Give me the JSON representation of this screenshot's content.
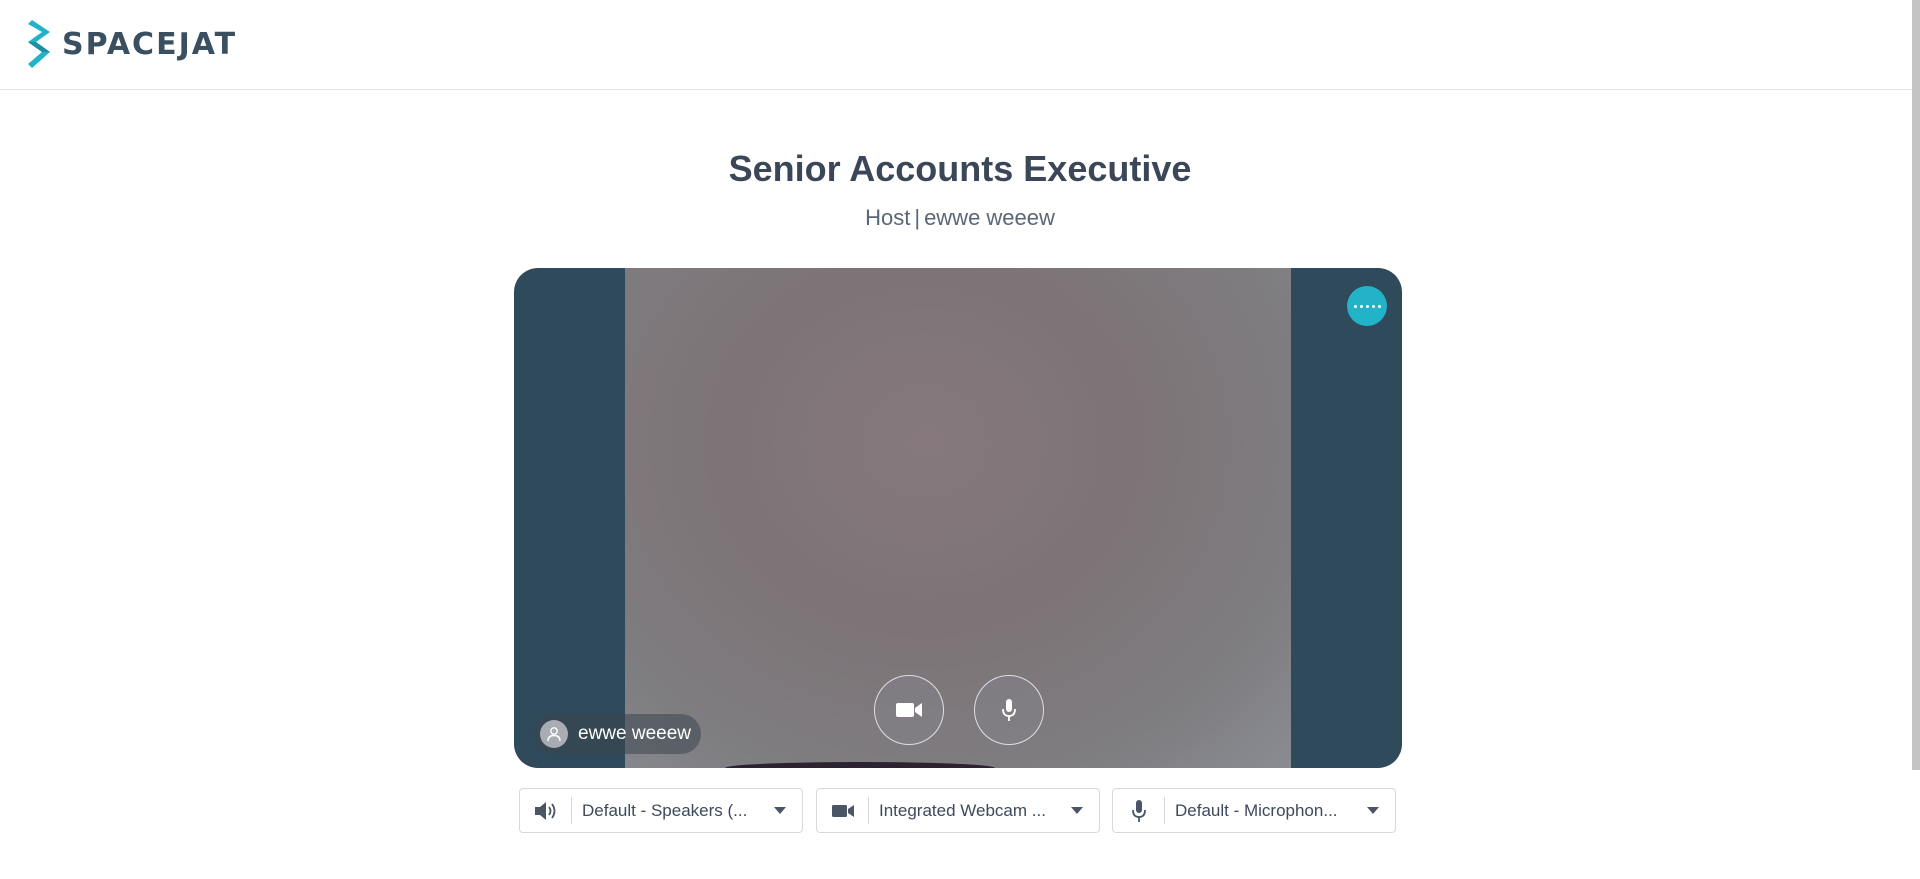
{
  "brand": {
    "name": "SPACEJAT",
    "accent": "#22b3c9"
  },
  "meeting": {
    "title": "Senior Accounts Executive",
    "role": "Host",
    "separator": "|",
    "host_name": "ewwe weeew"
  },
  "video": {
    "participant_name": "ewwe weeew",
    "more_icon": "more-dots-icon",
    "camera_icon": "video-camera-icon",
    "mic_icon": "microphone-icon"
  },
  "devices": {
    "speaker": {
      "icon": "speaker-icon",
      "label": "Default - Speakers (..."
    },
    "camera": {
      "icon": "video-camera-icon",
      "label": "Integrated Webcam ..."
    },
    "microphone": {
      "icon": "microphone-icon",
      "label": "Default - Microphon..."
    }
  }
}
